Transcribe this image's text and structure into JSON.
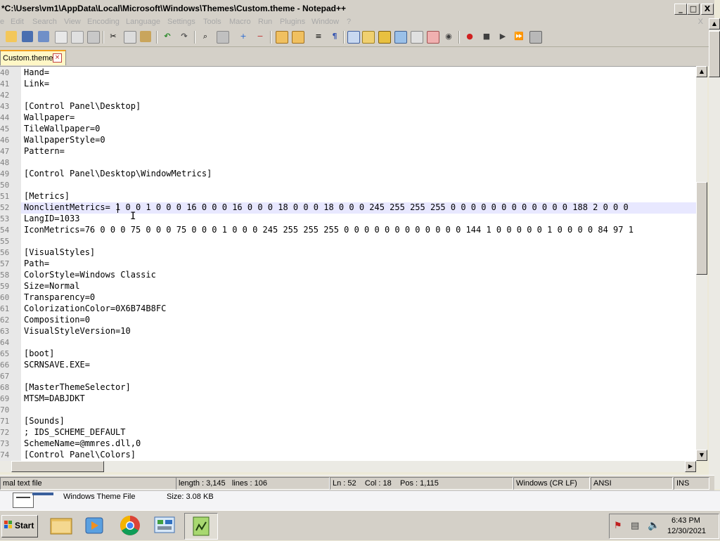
{
  "window": {
    "title": "*C:\\Users\\vm1\\AppData\\Local\\Microsoft\\Windows\\Themes\\Custom.theme - Notepad++",
    "minimize": "_",
    "maximize": "□",
    "close": "X"
  },
  "menu": {
    "items": [
      "e",
      "Edit",
      "Search",
      "View",
      "Encoding",
      "Language",
      "Settings",
      "Tools",
      "Macro",
      "Run",
      "Plugins",
      "Window",
      "?"
    ],
    "close": "X"
  },
  "tab": {
    "label": "Custom.theme",
    "close": "×"
  },
  "editor": {
    "lines": [
      {
        "num": "40",
        "text": "Hand="
      },
      {
        "num": "41",
        "text": "Link="
      },
      {
        "num": "42",
        "text": ""
      },
      {
        "num": "43",
        "text": "[Control Panel\\Desktop]"
      },
      {
        "num": "44",
        "text": "Wallpaper="
      },
      {
        "num": "45",
        "text": "TileWallpaper=0"
      },
      {
        "num": "46",
        "text": "WallpaperStyle=0"
      },
      {
        "num": "47",
        "text": "Pattern="
      },
      {
        "num": "48",
        "text": ""
      },
      {
        "num": "49",
        "text": "[Control Panel\\Desktop\\WindowMetrics]"
      },
      {
        "num": "50",
        "text": ""
      },
      {
        "num": "51",
        "text": "[Metrics]"
      },
      {
        "num": "52",
        "text": "NonclientMetrics= 1 0 0 1 0 0 0 16 0 0 0 16 0 0 0 18 0 0 0 18 0 0 0 245 255 255 255 0 0 0 0 0 0 0 0 0 0 0 0 188 2 0 0 0"
      },
      {
        "num": "53",
        "text": "LangID=1033"
      },
      {
        "num": "54",
        "text": "IconMetrics=76 0 0 0 75 0 0 0 75 0 0 0 1 0 0 0 245 255 255 255 0 0 0 0 0 0 0 0 0 0 0 0 144 1 0 0 0 0 0 1 0 0 0 0 84 97 1"
      },
      {
        "num": "55",
        "text": ""
      },
      {
        "num": "56",
        "text": "[VisualStyles]"
      },
      {
        "num": "57",
        "text": "Path="
      },
      {
        "num": "58",
        "text": "ColorStyle=Windows Classic"
      },
      {
        "num": "59",
        "text": "Size=Normal"
      },
      {
        "num": "60",
        "text": "Transparency=0"
      },
      {
        "num": "61",
        "text": "ColorizationColor=0X6B74B8FC"
      },
      {
        "num": "62",
        "text": "Composition=0"
      },
      {
        "num": "63",
        "text": "VisualStyleVersion=10"
      },
      {
        "num": "64",
        "text": ""
      },
      {
        "num": "65",
        "text": "[boot]"
      },
      {
        "num": "66",
        "text": "SCRNSAVE.EXE="
      },
      {
        "num": "67",
        "text": ""
      },
      {
        "num": "68",
        "text": "[MasterThemeSelector]"
      },
      {
        "num": "69",
        "text": "MTSM=DABJDKT"
      },
      {
        "num": "70",
        "text": ""
      },
      {
        "num": "71",
        "text": "[Sounds]"
      },
      {
        "num": "72",
        "text": "; IDS_SCHEME_DEFAULT"
      },
      {
        "num": "73",
        "text": "SchemeName=@mmres.dll,0"
      },
      {
        "num": "74",
        "text": "[Control Panel\\Colors]"
      }
    ],
    "ibeam": "I"
  },
  "status": {
    "filetype": "mal text file",
    "length": "length : 3,145",
    "lines": "lines : 106",
    "ln": "Ln : 52",
    "col": "Col : 18",
    "pos": "Pos : 1,115",
    "eol": "Windows (CR LF)",
    "encoding": "ANSI",
    "mode": "INS"
  },
  "details": {
    "type": "Windows Theme File",
    "size": "Size: 3.08 KB"
  },
  "taskbar": {
    "start": "Start",
    "time": "6:43 PM",
    "date": "12/30/2021"
  },
  "colors": {
    "current_line": "#e8e8ff",
    "tab_active": "#fff7c6",
    "chrome": "#d4d0c8"
  }
}
